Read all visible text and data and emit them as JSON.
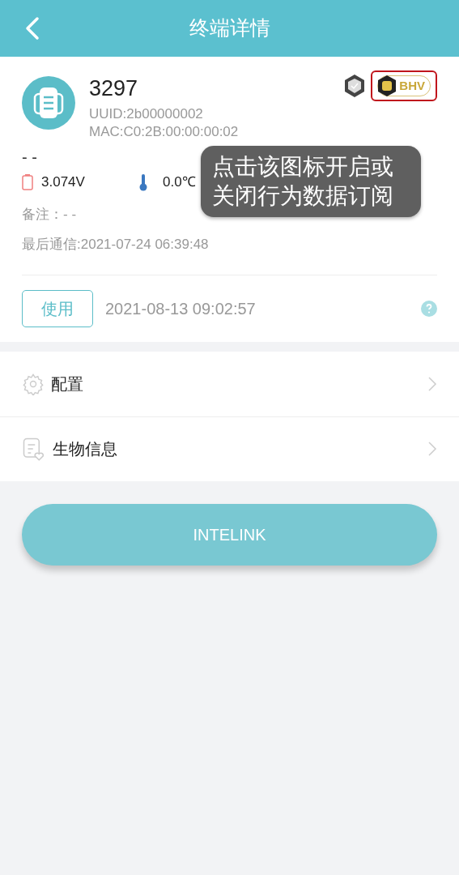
{
  "header": {
    "title": "终端详情"
  },
  "device": {
    "name": "3297",
    "uuid": "UUID:2b00000002",
    "mac": "MAC:C0:2B:00:00:00:02",
    "badge": "BHV",
    "highlighted": true,
    "status": "- -",
    "voltage": "3.074V",
    "temperature": "0.0℃",
    "note": "备注：- -",
    "last_contact": "最后通信:2021-07-24 06:39:48"
  },
  "tooltip": "点击该图标开启或关闭行为数据订阅",
  "usage": {
    "button": "使用",
    "time": "2021-08-13 09:02:57"
  },
  "menu": [
    {
      "kind": "gear",
      "label": "配置"
    },
    {
      "kind": "bio",
      "label": "生物信息"
    }
  ],
  "action_button": "INTELINK"
}
